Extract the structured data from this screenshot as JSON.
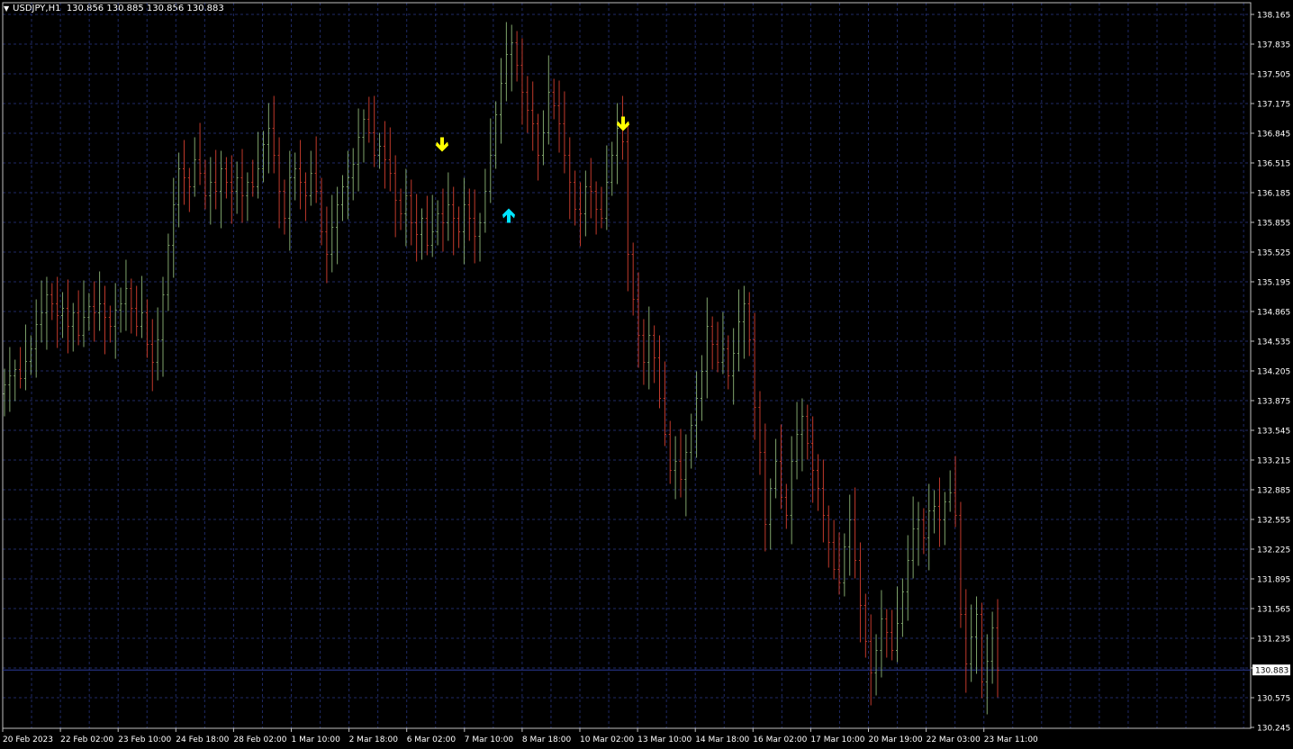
{
  "header": {
    "symbol": "USDJPY,H1",
    "ohlc": "130.856 130.885 130.856 130.883"
  },
  "price_axis": {
    "labels": [
      "138.165",
      "137.835",
      "137.505",
      "137.175",
      "136.845",
      "136.515",
      "136.185",
      "135.855",
      "135.525",
      "135.195",
      "134.865",
      "134.535",
      "134.205",
      "133.875",
      "133.545",
      "133.215",
      "132.885",
      "132.555",
      "132.225",
      "131.895",
      "131.565",
      "131.235",
      "130.905",
      "130.575",
      "130.245"
    ],
    "current": "130.883"
  },
  "time_axis": {
    "labels": [
      "20 Feb 2023",
      "22 Feb 02:00",
      "23 Feb 10:00",
      "24 Feb 18:00",
      "28 Feb 02:00",
      "1 Mar 10:00",
      "2 Mar 18:00",
      "6 Mar 02:00",
      "7 Mar 10:00",
      "8 Mar 18:00",
      "10 Mar 02:00",
      "13 Mar 10:00",
      "14 Mar 18:00",
      "16 Mar 02:00",
      "17 Mar 10:00",
      "20 Mar 19:00",
      "22 Mar 03:00",
      "23 Mar 11:00"
    ]
  },
  "colors": {
    "background": "#000000",
    "grid": "#1f2a66",
    "bull": "#7fa36b",
    "bear": "#c0392b",
    "axis_line": "#c0c0c0",
    "text": "#ffffff",
    "current_line": "#2a3a9c",
    "arrow_sell": "#ffff00",
    "arrow_buy": "#00e5ff"
  },
  "arrows": [
    {
      "type": "sell",
      "icon": "arrow-down-icon",
      "price": 136.72
    },
    {
      "type": "buy",
      "icon": "arrow-up-icon",
      "price": 135.93
    },
    {
      "type": "sell",
      "icon": "arrow-down-icon",
      "price": 136.95
    }
  ],
  "chart_data": {
    "type": "candlestick",
    "symbol": "USDJPY",
    "timeframe": "H1",
    "ylim": [
      130.245,
      138.165
    ],
    "closes": [
      134.05,
      134.15,
      134.22,
      134.12,
      134.31,
      134.45,
      134.72,
      134.85,
      135.05,
      134.95,
      134.82,
      134.9,
      134.7,
      134.85,
      134.6,
      134.8,
      134.92,
      134.85,
      134.95,
      134.8,
      134.7,
      134.88,
      134.95,
      135.12,
      134.9,
      134.7,
      134.85,
      134.5,
      134.3,
      134.55,
      135.05,
      135.6,
      136.05,
      136.45,
      136.35,
      136.25,
      136.55,
      136.4,
      136.15,
      136.3,
      136.2,
      136.45,
      136.3,
      136.2,
      136.35,
      136.15,
      136.3,
      136.25,
      136.45,
      136.72,
      136.9,
      136.6,
      136.2,
      135.9,
      136.35,
      136.45,
      136.3,
      136.15,
      136.4,
      136.2,
      135.75,
      135.5,
      135.8,
      136.05,
      136.25,
      136.35,
      136.5,
      136.8,
      137.0,
      136.85,
      136.6,
      136.7,
      136.55,
      136.4,
      136.1,
      135.95,
      136.15,
      135.85,
      135.72,
      135.9,
      135.6,
      135.75,
      135.95,
      135.85,
      136.05,
      135.9,
      135.75,
      136.05,
      135.9,
      135.7,
      135.85,
      136.2,
      136.6,
      137.05,
      137.4,
      137.72,
      137.85,
      137.6,
      137.3,
      137.1,
      136.95,
      136.6,
      136.85,
      137.3,
      137.15,
      136.95,
      136.6,
      136.3,
      136.0,
      135.95,
      136.25,
      136.2,
      136.0,
      135.9,
      136.3,
      136.6,
      136.9,
      136.75,
      135.5,
      135.0,
      134.6,
      134.3,
      134.6,
      134.35,
      133.9,
      133.5,
      133.1,
      133.2,
      133.0,
      133.3,
      133.6,
      133.9,
      134.2,
      134.7,
      134.5,
      134.3,
      134.45,
      134.15,
      134.4,
      134.75,
      134.95,
      134.55,
      133.8,
      133.3,
      132.5,
      132.9,
      133.2,
      132.8,
      132.6,
      133.2,
      133.5,
      133.7,
      133.4,
      133.1,
      132.9,
      132.6,
      132.3,
      132.0,
      131.85,
      132.25,
      132.55,
      132.1,
      131.6,
      131.2,
      130.85,
      131.1,
      131.45,
      131.3,
      131.1,
      131.4,
      131.75,
      132.1,
      132.45,
      132.55,
      132.35,
      132.65,
      132.7,
      132.55,
      132.75,
      132.85,
      132.6,
      131.5,
      130.95,
      131.25,
      131.5,
      130.75,
      130.98,
      131.35,
      130.88
    ],
    "series": [
      {
        "name": "USDJPY,H1"
      }
    ],
    "last_price": 130.883
  }
}
